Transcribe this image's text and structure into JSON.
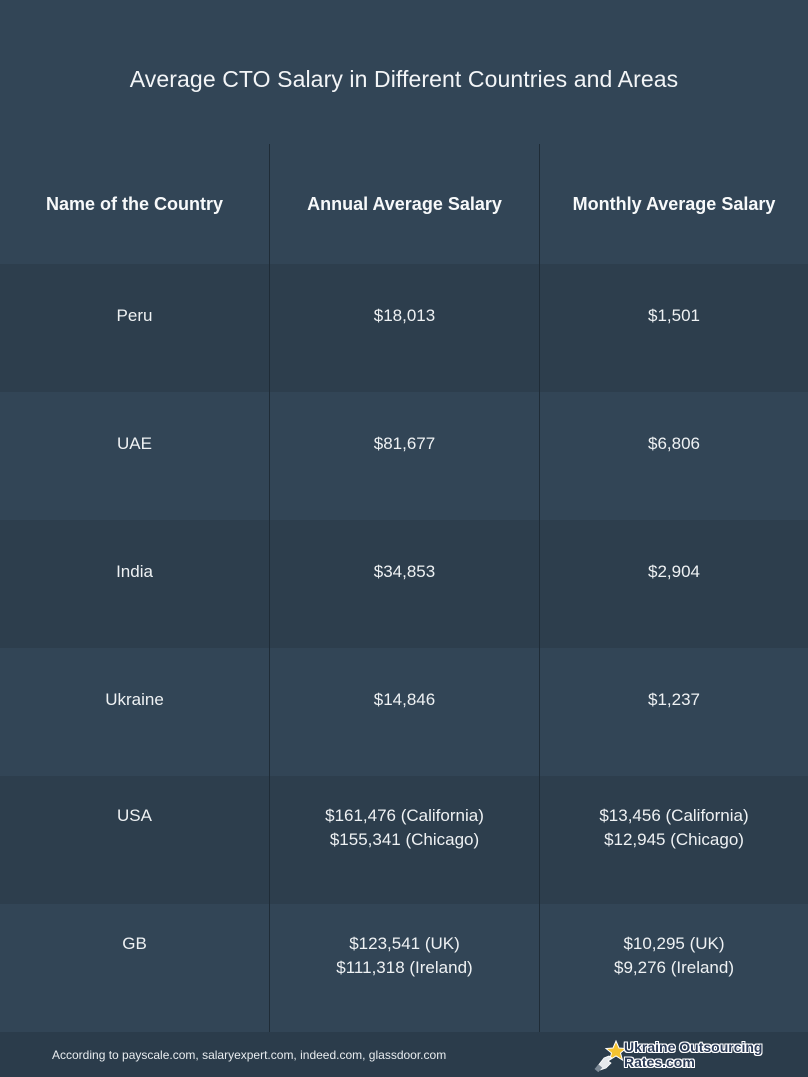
{
  "title": "Average CTO Salary in Different Countries and Areas",
  "table": {
    "headers": [
      "Name of the Country",
      "Annual Average Salary",
      "Monthly Average Salary"
    ],
    "rows": [
      {
        "country": "Peru",
        "annual": [
          "$18,013"
        ],
        "monthly": [
          "$1,501"
        ]
      },
      {
        "country": "UAE",
        "annual": [
          "$81,677"
        ],
        "monthly": [
          "$6,806"
        ]
      },
      {
        "country": "India",
        "annual": [
          "$34,853"
        ],
        "monthly": [
          "$2,904"
        ]
      },
      {
        "country": "Ukraine",
        "annual": [
          "$14,846"
        ],
        "monthly": [
          "$1,237"
        ]
      },
      {
        "country": "USA",
        "annual": [
          "$161,476 (California)",
          "$155,341 (Chicago)"
        ],
        "monthly": [
          "$13,456 (California)",
          "$12,945 (Chicago)"
        ]
      },
      {
        "country": "GB",
        "annual": [
          "$123,541 (UK)",
          "$111,318 (Ireland)"
        ],
        "monthly": [
          "$10,295 (UK)",
          "$9,276 (Ireland)"
        ]
      }
    ]
  },
  "footer": {
    "source": "According to payscale.com, salaryexpert.com, indeed.com, glassdoor.com",
    "logo": {
      "icon": "star-hand-icon",
      "line1": "Ukraine Outsourcing",
      "line2": "Rates.com"
    }
  },
  "colors": {
    "background": "#324556",
    "row_dark": "#2d3e4d",
    "row_light": "#324556",
    "footer": "#2b3c4b",
    "star": "#f5c330"
  }
}
